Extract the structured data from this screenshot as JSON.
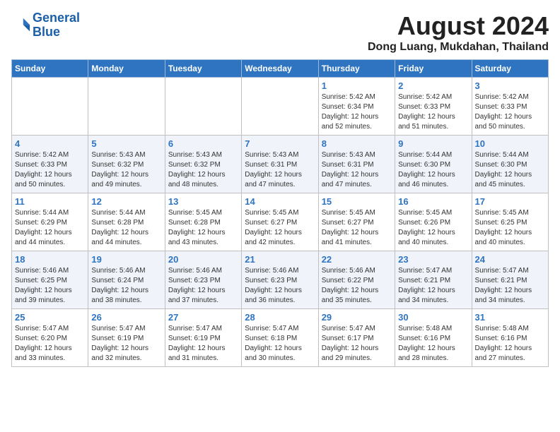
{
  "logo": {
    "line1": "General",
    "line2": "Blue"
  },
  "title": "August 2024",
  "location": "Dong Luang, Mukdahan, Thailand",
  "weekdays": [
    "Sunday",
    "Monday",
    "Tuesday",
    "Wednesday",
    "Thursday",
    "Friday",
    "Saturday"
  ],
  "weeks": [
    [
      {
        "day": "",
        "info": ""
      },
      {
        "day": "",
        "info": ""
      },
      {
        "day": "",
        "info": ""
      },
      {
        "day": "",
        "info": ""
      },
      {
        "day": "1",
        "info": "Sunrise: 5:42 AM\nSunset: 6:34 PM\nDaylight: 12 hours\nand 52 minutes."
      },
      {
        "day": "2",
        "info": "Sunrise: 5:42 AM\nSunset: 6:33 PM\nDaylight: 12 hours\nand 51 minutes."
      },
      {
        "day": "3",
        "info": "Sunrise: 5:42 AM\nSunset: 6:33 PM\nDaylight: 12 hours\nand 50 minutes."
      }
    ],
    [
      {
        "day": "4",
        "info": "Sunrise: 5:42 AM\nSunset: 6:33 PM\nDaylight: 12 hours\nand 50 minutes."
      },
      {
        "day": "5",
        "info": "Sunrise: 5:43 AM\nSunset: 6:32 PM\nDaylight: 12 hours\nand 49 minutes."
      },
      {
        "day": "6",
        "info": "Sunrise: 5:43 AM\nSunset: 6:32 PM\nDaylight: 12 hours\nand 48 minutes."
      },
      {
        "day": "7",
        "info": "Sunrise: 5:43 AM\nSunset: 6:31 PM\nDaylight: 12 hours\nand 47 minutes."
      },
      {
        "day": "8",
        "info": "Sunrise: 5:43 AM\nSunset: 6:31 PM\nDaylight: 12 hours\nand 47 minutes."
      },
      {
        "day": "9",
        "info": "Sunrise: 5:44 AM\nSunset: 6:30 PM\nDaylight: 12 hours\nand 46 minutes."
      },
      {
        "day": "10",
        "info": "Sunrise: 5:44 AM\nSunset: 6:30 PM\nDaylight: 12 hours\nand 45 minutes."
      }
    ],
    [
      {
        "day": "11",
        "info": "Sunrise: 5:44 AM\nSunset: 6:29 PM\nDaylight: 12 hours\nand 44 minutes."
      },
      {
        "day": "12",
        "info": "Sunrise: 5:44 AM\nSunset: 6:28 PM\nDaylight: 12 hours\nand 44 minutes."
      },
      {
        "day": "13",
        "info": "Sunrise: 5:45 AM\nSunset: 6:28 PM\nDaylight: 12 hours\nand 43 minutes."
      },
      {
        "day": "14",
        "info": "Sunrise: 5:45 AM\nSunset: 6:27 PM\nDaylight: 12 hours\nand 42 minutes."
      },
      {
        "day": "15",
        "info": "Sunrise: 5:45 AM\nSunset: 6:27 PM\nDaylight: 12 hours\nand 41 minutes."
      },
      {
        "day": "16",
        "info": "Sunrise: 5:45 AM\nSunset: 6:26 PM\nDaylight: 12 hours\nand 40 minutes."
      },
      {
        "day": "17",
        "info": "Sunrise: 5:45 AM\nSunset: 6:25 PM\nDaylight: 12 hours\nand 40 minutes."
      }
    ],
    [
      {
        "day": "18",
        "info": "Sunrise: 5:46 AM\nSunset: 6:25 PM\nDaylight: 12 hours\nand 39 minutes."
      },
      {
        "day": "19",
        "info": "Sunrise: 5:46 AM\nSunset: 6:24 PM\nDaylight: 12 hours\nand 38 minutes."
      },
      {
        "day": "20",
        "info": "Sunrise: 5:46 AM\nSunset: 6:23 PM\nDaylight: 12 hours\nand 37 minutes."
      },
      {
        "day": "21",
        "info": "Sunrise: 5:46 AM\nSunset: 6:23 PM\nDaylight: 12 hours\nand 36 minutes."
      },
      {
        "day": "22",
        "info": "Sunrise: 5:46 AM\nSunset: 6:22 PM\nDaylight: 12 hours\nand 35 minutes."
      },
      {
        "day": "23",
        "info": "Sunrise: 5:47 AM\nSunset: 6:21 PM\nDaylight: 12 hours\nand 34 minutes."
      },
      {
        "day": "24",
        "info": "Sunrise: 5:47 AM\nSunset: 6:21 PM\nDaylight: 12 hours\nand 34 minutes."
      }
    ],
    [
      {
        "day": "25",
        "info": "Sunrise: 5:47 AM\nSunset: 6:20 PM\nDaylight: 12 hours\nand 33 minutes."
      },
      {
        "day": "26",
        "info": "Sunrise: 5:47 AM\nSunset: 6:19 PM\nDaylight: 12 hours\nand 32 minutes."
      },
      {
        "day": "27",
        "info": "Sunrise: 5:47 AM\nSunset: 6:19 PM\nDaylight: 12 hours\nand 31 minutes."
      },
      {
        "day": "28",
        "info": "Sunrise: 5:47 AM\nSunset: 6:18 PM\nDaylight: 12 hours\nand 30 minutes."
      },
      {
        "day": "29",
        "info": "Sunrise: 5:47 AM\nSunset: 6:17 PM\nDaylight: 12 hours\nand 29 minutes."
      },
      {
        "day": "30",
        "info": "Sunrise: 5:48 AM\nSunset: 6:16 PM\nDaylight: 12 hours\nand 28 minutes."
      },
      {
        "day": "31",
        "info": "Sunrise: 5:48 AM\nSunset: 6:16 PM\nDaylight: 12 hours\nand 27 minutes."
      }
    ]
  ]
}
